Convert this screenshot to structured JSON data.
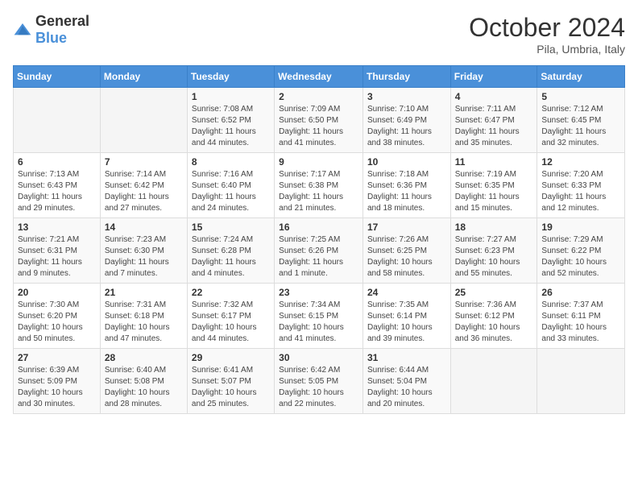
{
  "header": {
    "logo_general": "General",
    "logo_blue": "Blue",
    "month": "October 2024",
    "location": "Pila, Umbria, Italy"
  },
  "weekdays": [
    "Sunday",
    "Monday",
    "Tuesday",
    "Wednesday",
    "Thursday",
    "Friday",
    "Saturday"
  ],
  "weeks": [
    [
      {
        "day": "",
        "info": ""
      },
      {
        "day": "",
        "info": ""
      },
      {
        "day": "1",
        "info": "Sunrise: 7:08 AM\nSunset: 6:52 PM\nDaylight: 11 hours and 44 minutes."
      },
      {
        "day": "2",
        "info": "Sunrise: 7:09 AM\nSunset: 6:50 PM\nDaylight: 11 hours and 41 minutes."
      },
      {
        "day": "3",
        "info": "Sunrise: 7:10 AM\nSunset: 6:49 PM\nDaylight: 11 hours and 38 minutes."
      },
      {
        "day": "4",
        "info": "Sunrise: 7:11 AM\nSunset: 6:47 PM\nDaylight: 11 hours and 35 minutes."
      },
      {
        "day": "5",
        "info": "Sunrise: 7:12 AM\nSunset: 6:45 PM\nDaylight: 11 hours and 32 minutes."
      }
    ],
    [
      {
        "day": "6",
        "info": "Sunrise: 7:13 AM\nSunset: 6:43 PM\nDaylight: 11 hours and 29 minutes."
      },
      {
        "day": "7",
        "info": "Sunrise: 7:14 AM\nSunset: 6:42 PM\nDaylight: 11 hours and 27 minutes."
      },
      {
        "day": "8",
        "info": "Sunrise: 7:16 AM\nSunset: 6:40 PM\nDaylight: 11 hours and 24 minutes."
      },
      {
        "day": "9",
        "info": "Sunrise: 7:17 AM\nSunset: 6:38 PM\nDaylight: 11 hours and 21 minutes."
      },
      {
        "day": "10",
        "info": "Sunrise: 7:18 AM\nSunset: 6:36 PM\nDaylight: 11 hours and 18 minutes."
      },
      {
        "day": "11",
        "info": "Sunrise: 7:19 AM\nSunset: 6:35 PM\nDaylight: 11 hours and 15 minutes."
      },
      {
        "day": "12",
        "info": "Sunrise: 7:20 AM\nSunset: 6:33 PM\nDaylight: 11 hours and 12 minutes."
      }
    ],
    [
      {
        "day": "13",
        "info": "Sunrise: 7:21 AM\nSunset: 6:31 PM\nDaylight: 11 hours and 9 minutes."
      },
      {
        "day": "14",
        "info": "Sunrise: 7:23 AM\nSunset: 6:30 PM\nDaylight: 11 hours and 7 minutes."
      },
      {
        "day": "15",
        "info": "Sunrise: 7:24 AM\nSunset: 6:28 PM\nDaylight: 11 hours and 4 minutes."
      },
      {
        "day": "16",
        "info": "Sunrise: 7:25 AM\nSunset: 6:26 PM\nDaylight: 11 hours and 1 minute."
      },
      {
        "day": "17",
        "info": "Sunrise: 7:26 AM\nSunset: 6:25 PM\nDaylight: 10 hours and 58 minutes."
      },
      {
        "day": "18",
        "info": "Sunrise: 7:27 AM\nSunset: 6:23 PM\nDaylight: 10 hours and 55 minutes."
      },
      {
        "day": "19",
        "info": "Sunrise: 7:29 AM\nSunset: 6:22 PM\nDaylight: 10 hours and 52 minutes."
      }
    ],
    [
      {
        "day": "20",
        "info": "Sunrise: 7:30 AM\nSunset: 6:20 PM\nDaylight: 10 hours and 50 minutes."
      },
      {
        "day": "21",
        "info": "Sunrise: 7:31 AM\nSunset: 6:18 PM\nDaylight: 10 hours and 47 minutes."
      },
      {
        "day": "22",
        "info": "Sunrise: 7:32 AM\nSunset: 6:17 PM\nDaylight: 10 hours and 44 minutes."
      },
      {
        "day": "23",
        "info": "Sunrise: 7:34 AM\nSunset: 6:15 PM\nDaylight: 10 hours and 41 minutes."
      },
      {
        "day": "24",
        "info": "Sunrise: 7:35 AM\nSunset: 6:14 PM\nDaylight: 10 hours and 39 minutes."
      },
      {
        "day": "25",
        "info": "Sunrise: 7:36 AM\nSunset: 6:12 PM\nDaylight: 10 hours and 36 minutes."
      },
      {
        "day": "26",
        "info": "Sunrise: 7:37 AM\nSunset: 6:11 PM\nDaylight: 10 hours and 33 minutes."
      }
    ],
    [
      {
        "day": "27",
        "info": "Sunrise: 6:39 AM\nSunset: 5:09 PM\nDaylight: 10 hours and 30 minutes."
      },
      {
        "day": "28",
        "info": "Sunrise: 6:40 AM\nSunset: 5:08 PM\nDaylight: 10 hours and 28 minutes."
      },
      {
        "day": "29",
        "info": "Sunrise: 6:41 AM\nSunset: 5:07 PM\nDaylight: 10 hours and 25 minutes."
      },
      {
        "day": "30",
        "info": "Sunrise: 6:42 AM\nSunset: 5:05 PM\nDaylight: 10 hours and 22 minutes."
      },
      {
        "day": "31",
        "info": "Sunrise: 6:44 AM\nSunset: 5:04 PM\nDaylight: 10 hours and 20 minutes."
      },
      {
        "day": "",
        "info": ""
      },
      {
        "day": "",
        "info": ""
      }
    ]
  ]
}
